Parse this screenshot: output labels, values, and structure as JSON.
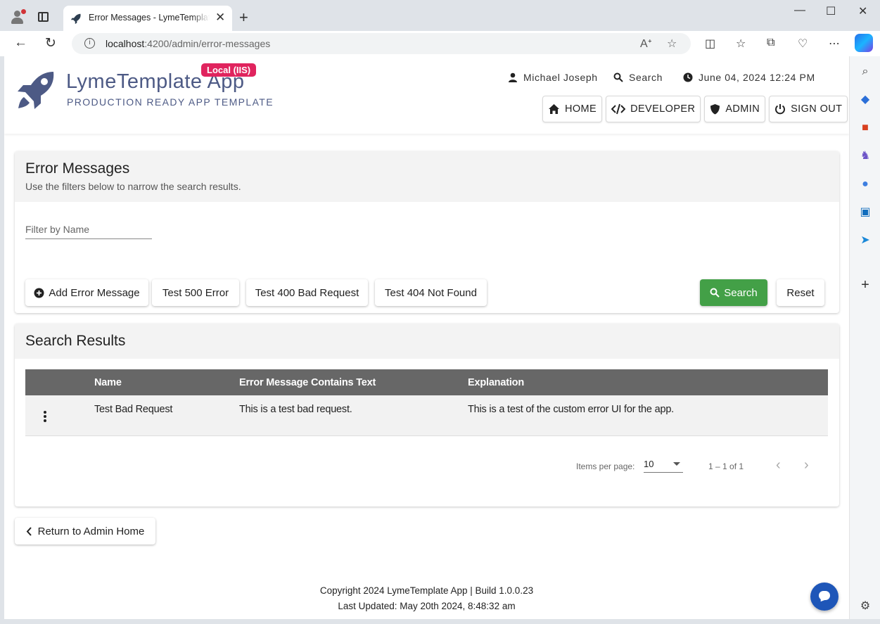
{
  "browser": {
    "tab_title": "Error Messages - LymeTemplate App",
    "tab_close": "✕",
    "new_tab": "+",
    "url_host": "localhost",
    "url_path": ":4200/admin/error-messages",
    "window_minimize": "—",
    "window_maximize": "☐",
    "window_close": "✕"
  },
  "header": {
    "app_name": "LymeTemplate App",
    "env_badge": "Local (IIS)",
    "subtitle": "PRODUCTION READY APP TEMPLATE",
    "user_name": "Michael Joseph",
    "search_label": "Search",
    "datetime": "June 04, 2024 12:24 PM",
    "nav": {
      "home": "HOME",
      "developer": "DEVELOPER",
      "admin": "ADMIN",
      "sign_out": "SIGN OUT"
    }
  },
  "filters_card": {
    "title": "Error Messages",
    "subtitle": "Use the filters below to narrow the search results.",
    "filter_placeholder": "Filter by Name",
    "buttons": {
      "add": "Add Error Message",
      "test500": "Test 500 Error",
      "test400": "Test 400 Bad Request",
      "test404": "Test 404 Not Found",
      "search": "Search",
      "reset": "Reset"
    }
  },
  "results_card": {
    "title": "Search Results",
    "columns": [
      "Name",
      "Error Message Contains Text",
      "Explanation"
    ],
    "rows": [
      {
        "name": "Test Bad Request",
        "contains": "This is a test bad request.",
        "explanation": "This is a test of the custom error UI for the app."
      }
    ],
    "items_per_page_label": "Items per page:",
    "items_per_page_value": "10",
    "range_label": "1 – 1 of 1"
  },
  "return_button": "Return to Admin Home",
  "footer": {
    "line1": "Copyright 2024 LymeTemplate App | Build 1.0.0.23",
    "line2": "Last Updated: May 20th 2024, 8:48:32 am"
  },
  "colors": {
    "brand": "#4d5a85",
    "badge": "#e0245e",
    "search_button": "#43a047",
    "table_header": "#676767",
    "chat_button": "#1e56b8"
  }
}
